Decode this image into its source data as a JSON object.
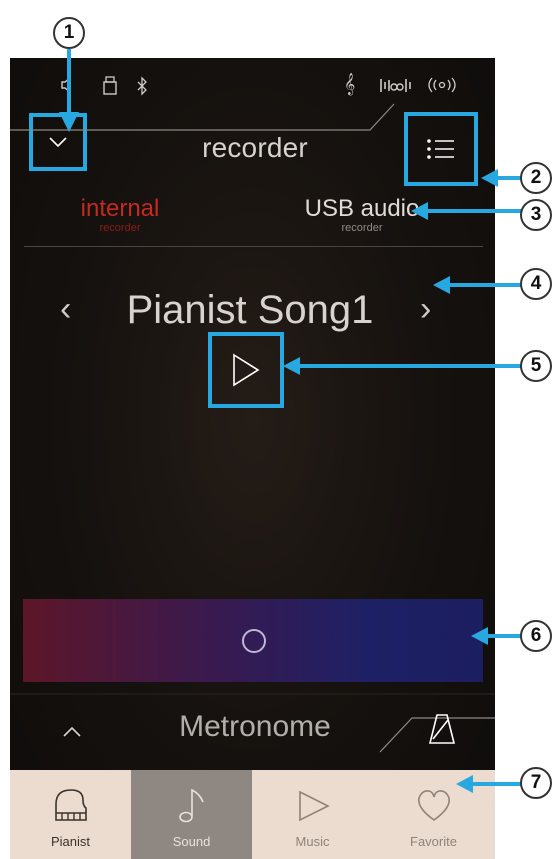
{
  "header": {
    "title": "recorder"
  },
  "tabs": {
    "internal": {
      "label": "internal",
      "sub": "recorder"
    },
    "usb": {
      "label": "USB audio",
      "sub": "recorder"
    }
  },
  "song": {
    "prev_glyph": "‹",
    "name": "Pianist Song1",
    "next_glyph": "›"
  },
  "metronome": {
    "label": "Metronome"
  },
  "bottom_nav": {
    "items": [
      {
        "label": "Pianist",
        "icon": "piano-icon",
        "active": true
      },
      {
        "label": "Sound",
        "icon": "music-note-icon",
        "selected": true
      },
      {
        "label": "Music",
        "icon": "play-outline-icon"
      },
      {
        "label": "Favorite",
        "icon": "heart-icon"
      }
    ]
  },
  "status_icons": [
    "usb-icon",
    "bluetooth-icon",
    "treble-clef-icon",
    "audio-eq-icon",
    "wireless-icon"
  ],
  "callouts": [
    "1",
    "2",
    "3",
    "4",
    "5",
    "6",
    "7"
  ],
  "colors": {
    "highlight": "#27a8e0",
    "internal_recorder": "#c42a22",
    "nav_bg": "#ecdcd0",
    "nav_selected_bg": "#8f8882"
  }
}
